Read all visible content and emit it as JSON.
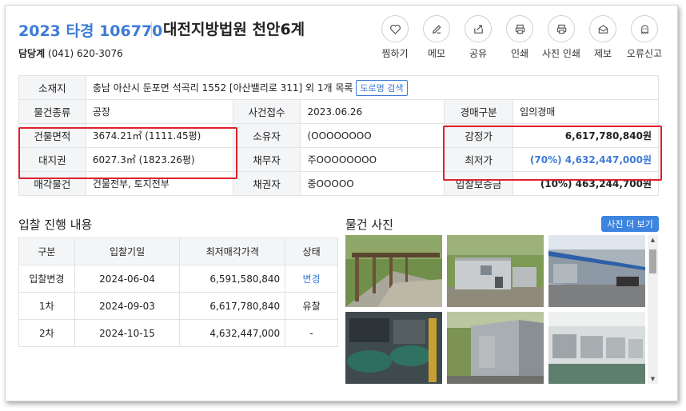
{
  "header": {
    "case_no": "2023 타경 106770",
    "court": "대전지방법원 천안6계",
    "contact_label": "담당계",
    "contact_phone": "(041) 620-3076"
  },
  "actions": [
    {
      "label": "찜하기",
      "icon": "heart-icon"
    },
    {
      "label": "메모",
      "icon": "pencil-icon"
    },
    {
      "label": "공유",
      "icon": "share-icon"
    },
    {
      "label": "인쇄",
      "icon": "printer-icon"
    },
    {
      "label": "사진 인쇄",
      "icon": "photo-printer-icon"
    },
    {
      "label": "제보",
      "icon": "mail-icon"
    },
    {
      "label": "오류신고",
      "icon": "ghost-icon"
    }
  ],
  "info": {
    "location_label": "소재지",
    "location_value": "충남 아산시 둔포면 석곡리 1552 [아산밸리로 311] 외 1개 목록",
    "road_button": "도로명 검색",
    "type_label": "물건종류",
    "type_value": "공장",
    "received_label": "사건접수",
    "received_value": "2023.06.26",
    "auction_type_label": "경매구분",
    "auction_type_value": "임의경매",
    "building_area_label": "건물면적",
    "building_area_value": "3674.21㎡ (1111.45평)",
    "owner_label": "소유자",
    "owner_value": "(OOOOOOOO",
    "appraisal_label": "감정가",
    "appraisal_value": "6,617,780,840원",
    "land_label": "대지권",
    "land_value": "6027.3㎡ (1823.26평)",
    "debtor_label": "채무자",
    "debtor_value": "주OOOOOOOO",
    "min_price_label": "최저가",
    "min_price_value": "(70%) 4,632,447,000원",
    "sale_item_label": "매각물건",
    "sale_item_value": "건물전부, 토지전부",
    "creditor_label": "채권자",
    "creditor_value": "중OOOOO",
    "deposit_label": "입찰보증금",
    "deposit_value": "(10%) 463,244,700원"
  },
  "bids": {
    "title": "입찰 진행 내용",
    "headers": [
      "구분",
      "입찰기일",
      "최저매각가격",
      "상태"
    ],
    "rows": [
      [
        "입찰변경",
        "2024-06-04",
        "6,591,580,840",
        "변경"
      ],
      [
        "1차",
        "2024-09-03",
        "6,617,780,840",
        "유찰"
      ],
      [
        "2차",
        "2024-10-15",
        "4,632,447,000",
        "-"
      ]
    ]
  },
  "photos": {
    "title": "물건 사진",
    "more_button": "사진 더 보기"
  },
  "colors": {
    "accent": "#3d7bd6",
    "highlight": "#e0202c",
    "header_cell": "#f4f5f7"
  }
}
